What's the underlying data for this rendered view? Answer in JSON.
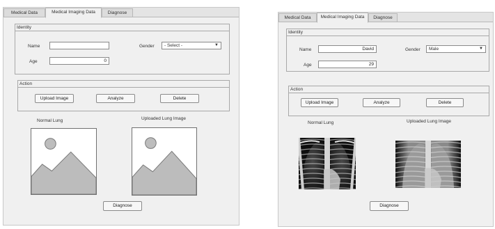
{
  "tabs": [
    "Medical Data",
    "Medical Imaging Data",
    "Diagnose"
  ],
  "identity": {
    "title": "Identity",
    "name_label": "Name",
    "age_label": "Age",
    "gender_label": "Gender"
  },
  "action": {
    "title": "Action",
    "upload_label": "Upload Image",
    "analyze_label": "Analyze",
    "delete_label": "Delete"
  },
  "images": {
    "normal_label": "Normal Lung",
    "uploaded_label": "Uploaded Lung Image"
  },
  "diagnose_label": "Diagnose",
  "before": {
    "name_value": "",
    "age_value": "0",
    "gender_value": "- Select -"
  },
  "after": {
    "name_value": "David",
    "age_value": "29",
    "gender_value": "Male"
  },
  "icons": {
    "dropdown": "chevron-down-icon",
    "placeholder": "image-placeholder-icon"
  },
  "colors": {
    "window_bg": "#f0f0f0",
    "tab_bar": "#e4e4e4",
    "placeholder_fill": "#b8b8b8"
  }
}
